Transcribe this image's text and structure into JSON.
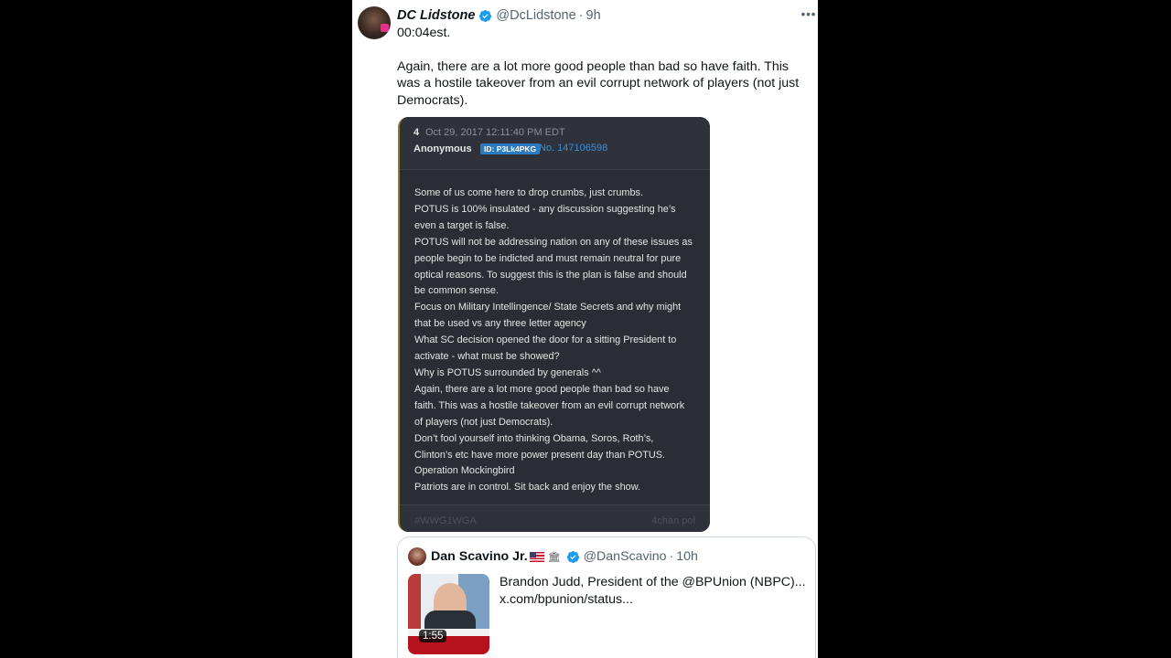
{
  "tweet": {
    "display_name": "DC Lidstone",
    "handle": "@DcLidstone",
    "time": "9h",
    "separator": "·",
    "more": "•••",
    "text_line1": "00:04est.",
    "text_line2": "Again, there are a lot more good people than bad so have faith. This was a hostile takeover from an evil corrupt network of players (not just Democrats)."
  },
  "quote_image": {
    "post_number": "4",
    "date": "Oct 29, 2017 12:11:40 PM EDT",
    "author": "Anonymous",
    "id_badge": "ID: P3Lk4PKG",
    "post_no": "No. 147106598",
    "lines": [
      "Some of us come here to drop crumbs, just crumbs.",
      "POTUS is 100% insulated - any discussion suggesting he’s",
      "even a target is false.",
      "POTUS will not be addressing nation on any of these issues as",
      "people begin to be indicted and must remain neutral for pure",
      "optical reasons. To suggest this is the plan is false and should",
      "be common sense.",
      "Focus on Military Intellingence/ State Secrets and why might",
      "that be used vs any three letter agency",
      "What SC decision opened the door for a sitting President to",
      "activate - what must be showed?",
      "Why is POTUS surrounded by generals ^^",
      "Again, there are a lot more good people than bad so have",
      "faith. This was a hostile takeover from an evil corrupt network",
      "of players (not just Democrats).",
      "Don’t fool yourself into thinking Obama, Soros, Roth’s,",
      "Clinton’s etc have more power present day than POTUS.",
      "Operation Mockingbird",
      "Patriots are in control. Sit back and enjoy the show."
    ],
    "tag": "#WWG1WGA",
    "source": "4chan pol"
  },
  "nested_tweet": {
    "display_name": "Dan Scavino Jr.",
    "handle": "@DanScavino",
    "time": "10h",
    "separator": "·",
    "video_duration": "1:55",
    "text_line1": "Brandon Judd, President of the @BPUnion (NBPC)...",
    "text_line2": "x.com/bpunion/status..."
  }
}
